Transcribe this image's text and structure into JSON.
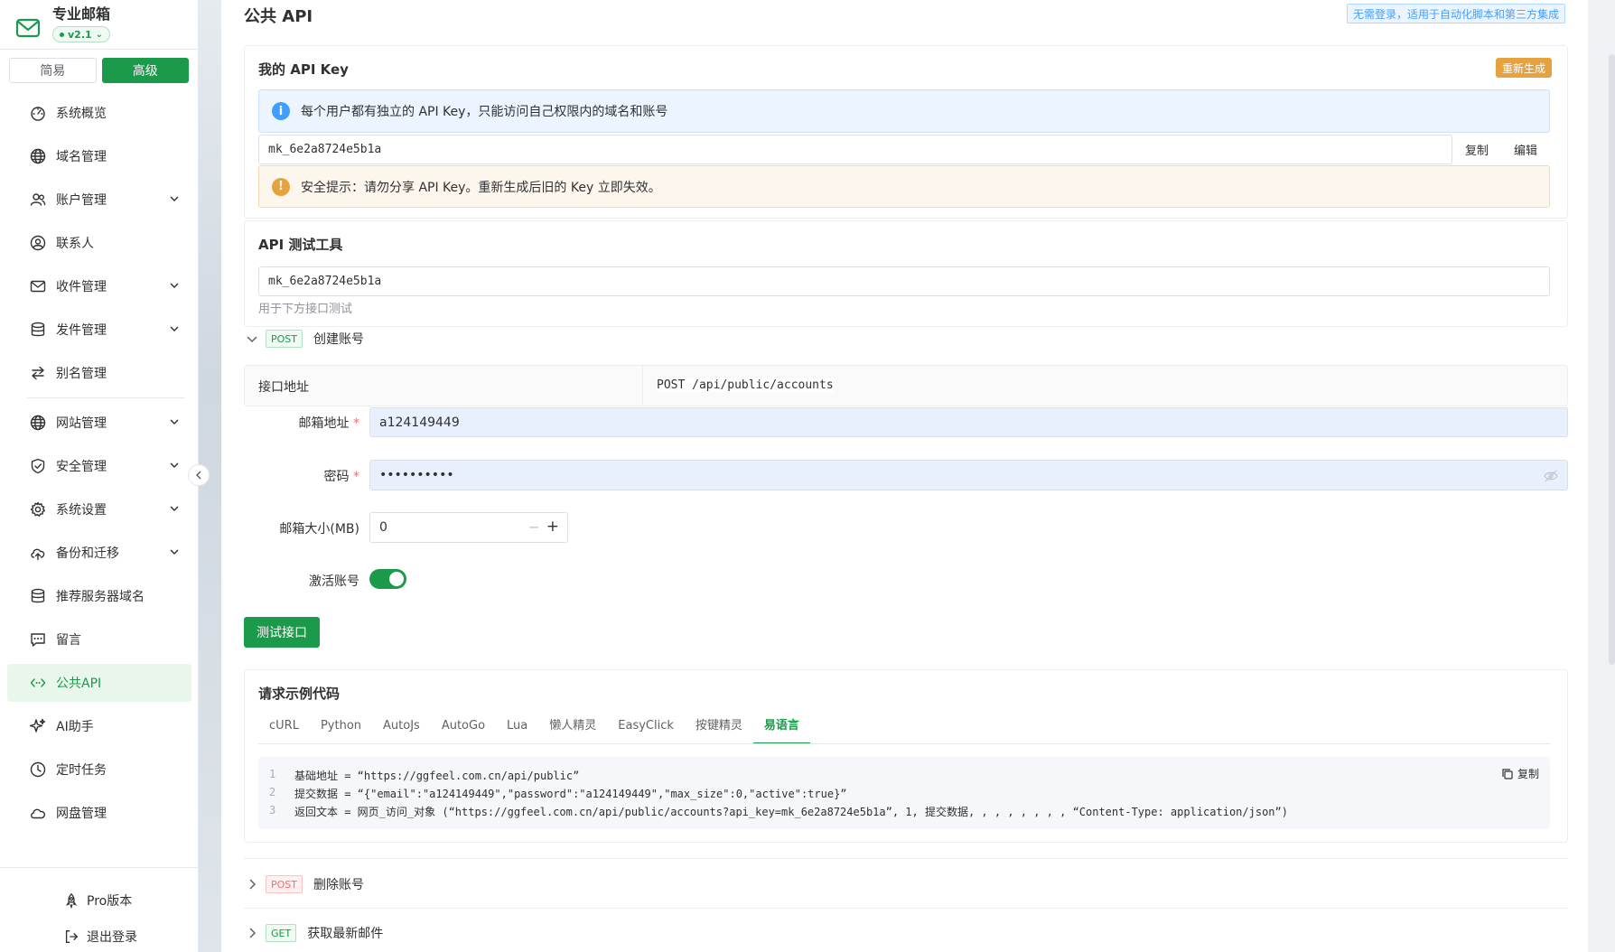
{
  "brand": {
    "name": "专业邮箱",
    "version": "v2.1"
  },
  "mode": {
    "simple": "简易",
    "advanced": "高级"
  },
  "nav": [
    {
      "label": "系统概览",
      "icon": "dashboard-icon",
      "expand": false
    },
    {
      "label": "域名管理",
      "icon": "globe-icon",
      "expand": false
    },
    {
      "label": "账户管理",
      "icon": "users-icon",
      "expand": true
    },
    {
      "label": "联系人",
      "icon": "contact-icon",
      "expand": false
    },
    {
      "label": "收件管理",
      "icon": "mail-icon",
      "expand": true
    },
    {
      "label": "发件管理",
      "icon": "database-icon",
      "expand": true
    },
    {
      "label": "别名管理",
      "icon": "swap-icon",
      "expand": false
    },
    {
      "label": "网站管理",
      "icon": "globe-icon",
      "expand": true
    },
    {
      "label": "安全管理",
      "icon": "shield-icon",
      "expand": true
    },
    {
      "label": "系统设置",
      "icon": "gear-icon",
      "expand": true
    },
    {
      "label": "备份和迁移",
      "icon": "cloud-upload-icon",
      "expand": true
    },
    {
      "label": "推荐服务器域名",
      "icon": "database-icon",
      "expand": false
    },
    {
      "label": "留言",
      "icon": "message-icon",
      "expand": false
    },
    {
      "label": "公共API",
      "icon": "code-icon",
      "expand": false,
      "active": true
    },
    {
      "label": "AI助手",
      "icon": "sparkle-icon",
      "expand": false
    },
    {
      "label": "定时任务",
      "icon": "clock-icon",
      "expand": false
    },
    {
      "label": "网盘管理",
      "icon": "cloud-icon",
      "expand": false
    }
  ],
  "bottom": {
    "pro": "Pro版本",
    "logout": "退出登录"
  },
  "page": {
    "title": "公共 API",
    "hint": "无需登录，适用于自动化脚本和第三方集成"
  },
  "apikey": {
    "title": "我的 API Key",
    "regen": "重新生成",
    "info": "每个用户都有独立的 API Key，只能访问自己权限内的域名和账号",
    "value": "mk_6e2a8724e5b1a",
    "copy": "复制",
    "edit": "编辑",
    "warning": "安全提示：请勿分享 API Key。重新生成后旧的 Key 立即失效。"
  },
  "tester": {
    "title": "API 测试工具",
    "key_value": "mk_6e2a8724e5b1a",
    "key_hint": "用于下方接口测试"
  },
  "endpoints": [
    {
      "method": "POST",
      "label": "创建账号"
    },
    {
      "method": "POST",
      "label": "删除账号"
    },
    {
      "method": "GET",
      "label": "获取最新邮件"
    }
  ],
  "create_account": {
    "addr_label": "接口地址",
    "addr_value": "POST /api/public/accounts",
    "email_label": "邮箱地址",
    "email_value": "a124149449",
    "password_label": "密码",
    "password_value": "••••••••••",
    "size_label": "邮箱大小(MB)",
    "size_value": "0",
    "active_label": "激活账号",
    "active": true,
    "submit": "测试接口"
  },
  "samples": {
    "title": "请求示例代码",
    "tabs": [
      "cURL",
      "Python",
      "AutoJs",
      "AutoGo",
      "Lua",
      "懒人精灵",
      "EasyClick",
      "按键精灵",
      "易语言"
    ],
    "active_tab": "易语言",
    "copy": "复制",
    "lines": [
      "基础地址 = “https://ggfeel.com.cn/api/public”",
      "提交数据 = “{\"email\":\"a124149449\",\"password\":\"a124149449\",\"max_size\":0,\"active\":true}”",
      "返回文本 = 网页_访问_对象 (“https://ggfeel.com.cn/api/public/accounts?api_key=mk_6e2a8724e5b1a”, 1, 提交数据, , , , , , , , “Content-Type: application/json”)"
    ]
  },
  "colors": {
    "accent": "#1a9a4a",
    "info": "#409eff",
    "warning": "#e6a23c",
    "danger": "#f56c6c"
  }
}
